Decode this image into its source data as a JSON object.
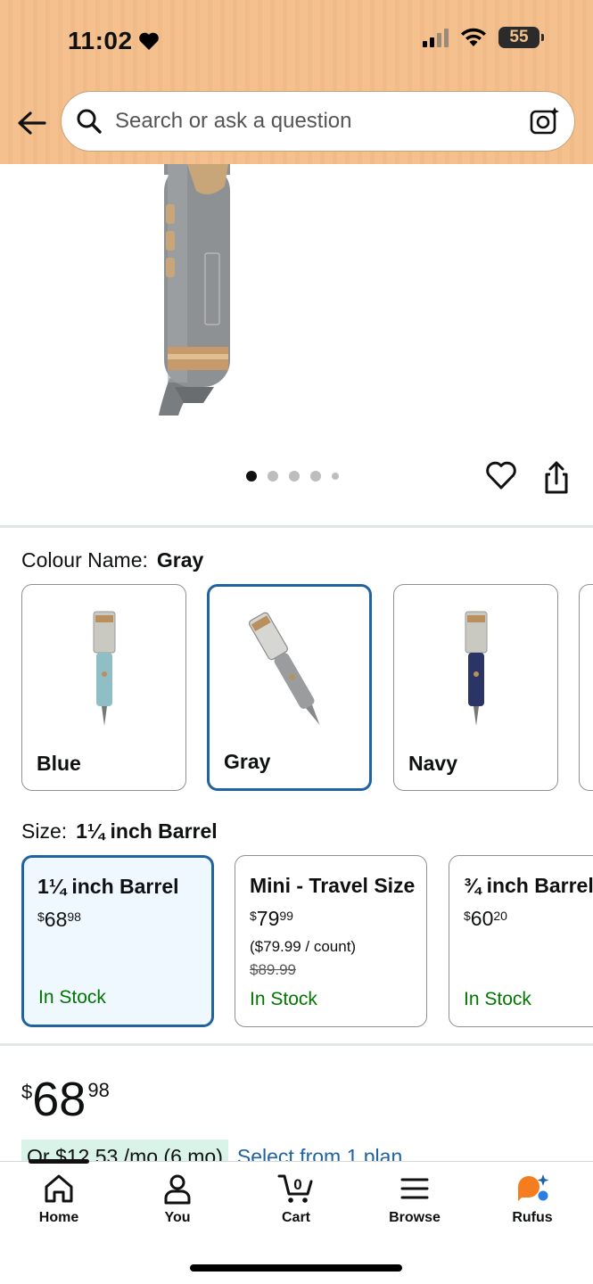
{
  "status_bar": {
    "time": "11:02",
    "battery": "55"
  },
  "search": {
    "placeholder": "Search or ask a question"
  },
  "gallery": {
    "image_count": 5,
    "active_index": 0
  },
  "colour": {
    "label": "Colour Name:",
    "selected": "Gray",
    "options": [
      {
        "name": "Blue",
        "color": "#8fbfc5"
      },
      {
        "name": "Gray",
        "color": "#9a9c9e"
      },
      {
        "name": "Navy",
        "color": "#2a3566"
      }
    ]
  },
  "size": {
    "label": "Size:",
    "selected": "1¼ inch Barrel",
    "options": [
      {
        "name": "1¼ inch Barrel",
        "currency": "$",
        "whole": "68",
        "cents": "98",
        "unit": "",
        "list_price": "",
        "stock": "In Stock"
      },
      {
        "name": "Mini - Travel Size",
        "currency": "$",
        "whole": "79",
        "cents": "99",
        "unit": "($79.99 / count)",
        "list_price": "$89.99",
        "stock": "In Stock"
      },
      {
        "name": "¾ inch Barrel",
        "currency": "$",
        "whole": "60",
        "cents": "20",
        "unit": "",
        "list_price": "",
        "stock": "In Stock"
      }
    ]
  },
  "price": {
    "currency": "$",
    "whole": "68",
    "cents": "98"
  },
  "installment": {
    "badge": "Or $12.53 /mo (6 mo)",
    "link": "Select from 1 plan"
  },
  "nav": {
    "home": "Home",
    "you": "You",
    "cart": "Cart",
    "cart_count": "0",
    "browse": "Browse",
    "rufus": "Rufus"
  },
  "colors": {
    "accent": "#2162a1",
    "stock": "#007600",
    "header": "#f4c08e",
    "rufus": "#f57c1f"
  }
}
